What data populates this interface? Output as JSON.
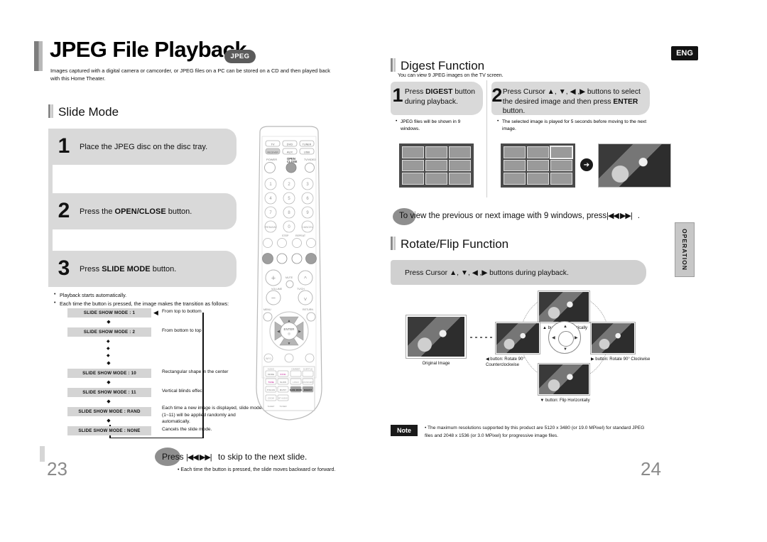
{
  "document": {
    "language_badge": "ENG",
    "side_tab": "OPERATION",
    "page_left": "23",
    "page_right": "24"
  },
  "left_page": {
    "title": "JPEG File Playback",
    "title_badge": "JPEG",
    "intro": "Images captured with a digital camera or camcorder, or JPEG files on a PC can be stored on a CD and then played back with this Home Theater.",
    "section_title": "Slide Mode",
    "steps": [
      {
        "num": "1",
        "text_plain": "Place the JPEG disc on the disc tray.",
        "pre": "Place the JPEG disc on the disc tray.",
        "bold": "",
        "post": ""
      },
      {
        "num": "2",
        "text_plain": "Press the OPEN/CLOSE button.",
        "pre": "Press the ",
        "bold": "OPEN/CLOSE",
        "post": " button."
      },
      {
        "num": "3",
        "text_plain": "Press SLIDE MODE button.",
        "pre": "Press ",
        "bold": "SLIDE MODE",
        "post": " button."
      }
    ],
    "bullets": [
      "Playback starts automatically.",
      "Each time the button is pressed, the image makes the transition as follows:"
    ],
    "flow": [
      {
        "chip": "SLIDE SHOW MODE : 1",
        "desc": "From top to bottom"
      },
      {
        "chip": "SLIDE SHOW MODE : 2",
        "desc": "From bottom to top"
      },
      {
        "chip": "SLIDE SHOW MODE : 10",
        "desc": "Rectangular shape in the center"
      },
      {
        "chip": "SLIDE SHOW MODE : 11",
        "desc": "Vertical blinds effect"
      },
      {
        "chip": "SLIDE SHOW MODE : RAND",
        "desc": "Each time a new image is displayed, slide modes (1~11) will be applied randomly and automatically."
      },
      {
        "chip": "SLIDE SHOW MODE : NONE",
        "desc": "Cancels the slide mode."
      }
    ],
    "press_line_pre": "Press",
    "press_line_icons": "|◀◀ ▶▶|",
    "press_line_post": "to skip to the next slide.",
    "press_sub": "Each time the button is pressed, the slide moves backward or forward."
  },
  "right_page": {
    "digest": {
      "section_title": "Digest Function",
      "subtitle": "You can view 9 JPEG images on the TV screen.",
      "steps": [
        {
          "num": "1",
          "pre": "Press ",
          "bold": "DIGEST",
          "post": " button during playback.",
          "note": "JPEG files will be shown in 9 windows."
        },
        {
          "num": "2",
          "pre": "Press Cursor ▲, ▼, ◀ ,▶ buttons to select the desired image and then press ",
          "bold": "ENTER",
          "post": " button.",
          "note": "The selected image is played for 5 seconds before moving to the next image."
        }
      ],
      "view_line_pre": "To view the previous or next image with 9 windows, press",
      "view_line_icons": "|◀◀ ▶▶|",
      "view_line_post": "."
    },
    "rotate": {
      "section_title": "Rotate/Flip Function",
      "instruction": "Press Cursor ▲, ▼, ◀ ,▶ buttons during playback.",
      "labels": {
        "original": "Original Image",
        "up": "▲ button: Flip Vertically",
        "down": "▼ button: Flip Horizontally",
        "left": "◀ button: Rotate 90° Counterclockwise",
        "right": "▶ button: Rotate 90° Clockwise"
      }
    },
    "note": {
      "badge": "Note",
      "text": "The maximum resolutions supported by this product are 5120 x 3480 (or 19.0 MPixel) for standard JPEG files and 2048 x 1536 (or 3.0 MPixel) for progressive image files."
    }
  },
  "remote": {
    "source_buttons": [
      "TV",
      "DVD",
      "TUNER",
      "DVD RECEIVER",
      "AUX",
      "USB"
    ],
    "labels": {
      "power": "POWER",
      "open_close": "OPEN/CLOSE",
      "tv_video": "TV/VIDEO",
      "volume": "VOLUME",
      "mute": "MUTE",
      "tv_ch": "TV/CH",
      "menu": "MENU",
      "return": "RETURN",
      "enter": "ENTER",
      "slide_mode": "SLIDE MODE",
      "digest": "DIGEST",
      "remain": "REMAIN",
      "cancel": "CANCEL",
      "step": "STEP",
      "repeat": "REPEAT",
      "info": "INFO",
      "mode": "MODE"
    },
    "keypad": [
      "1",
      "2",
      "3",
      "4",
      "5",
      "6",
      "7",
      "8",
      "9",
      "0"
    ]
  },
  "colors": {
    "step_box": "#d9d9d9",
    "chip": "#d4d4d4",
    "badge_dark": "#111111",
    "pill_gray": "#8e8e8e",
    "page_number": "#8a8a8a",
    "tab_gray": "#c7c7c7"
  }
}
